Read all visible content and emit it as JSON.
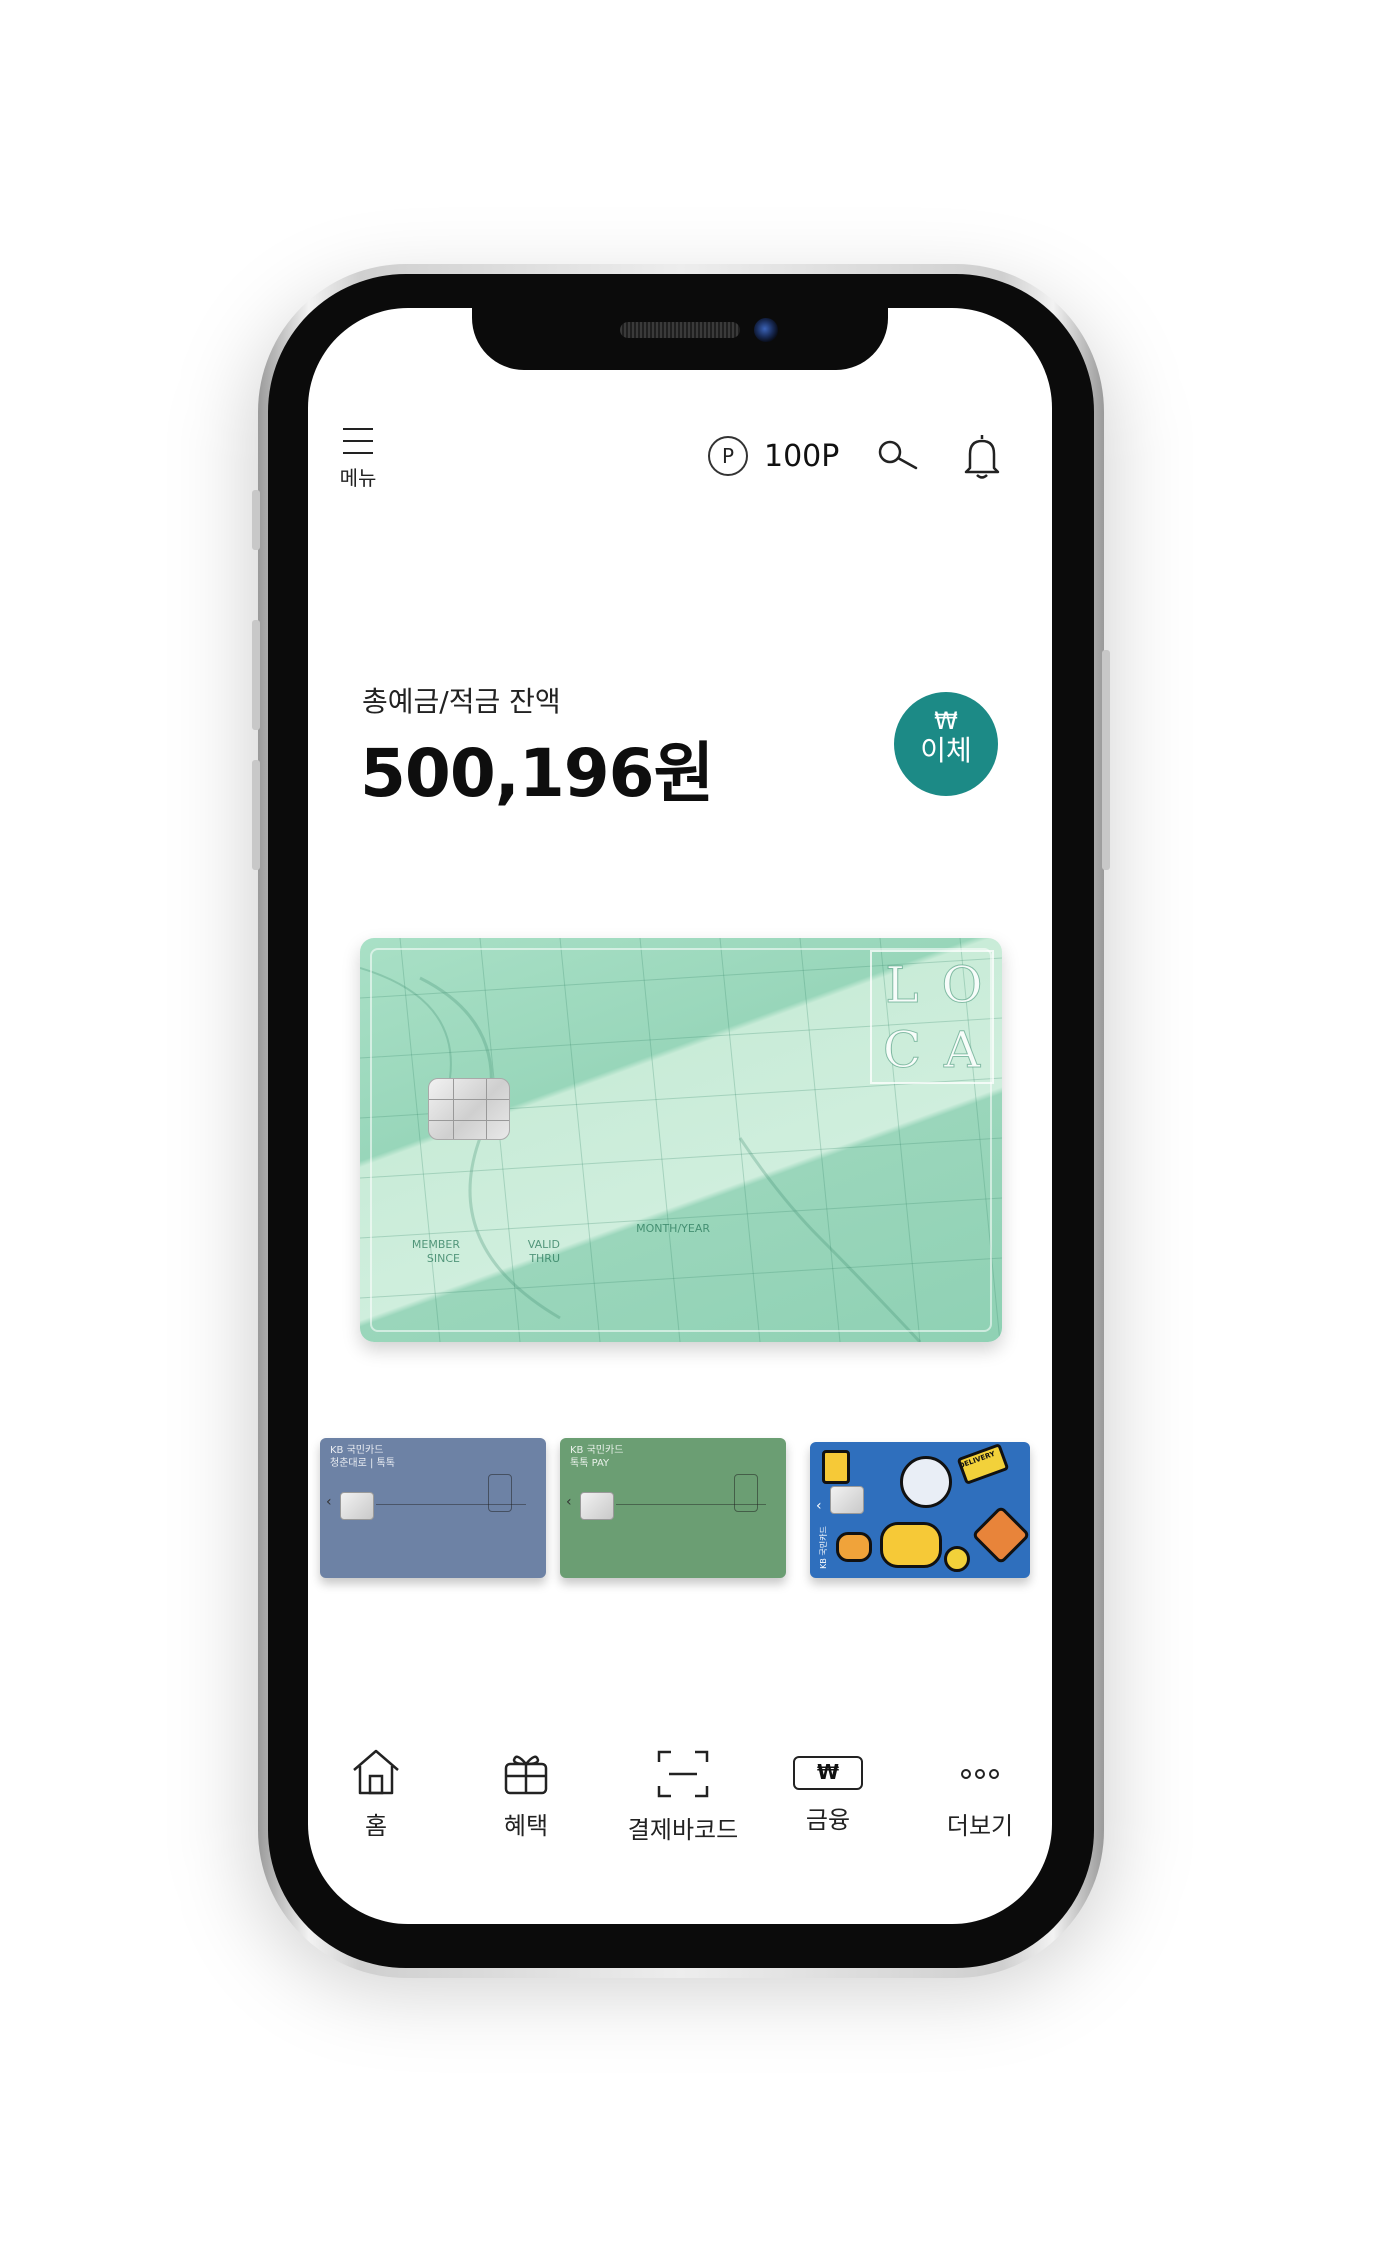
{
  "header": {
    "menu_label": "메뉴",
    "points_icon_letter": "P",
    "points_value": "100P",
    "icons": [
      "menu-icon",
      "points-icon",
      "search-icon",
      "bell-icon"
    ]
  },
  "balance": {
    "label": "총예금/적금 잔액",
    "amount": "500,196원"
  },
  "transfer_button": {
    "symbol": "₩",
    "label": "이체",
    "color": "#1c8a86"
  },
  "main_card": {
    "logo_letters": [
      "L",
      "O",
      "C",
      "A"
    ],
    "member_since": "MEMBER\nSINCE",
    "valid_thru": "VALID\nTHRU",
    "month_year": "MONTH/YEAR",
    "color": "#a9e0c6"
  },
  "mini_cards": [
    {
      "brand": "KB 국민카드",
      "subtitle": "청춘대로 | 톡톡",
      "color": "#6d82a5"
    },
    {
      "brand": "KB 국민카드",
      "subtitle": "톡톡 PAY",
      "color": "#6b9e73"
    },
    {
      "brand": "KB 국민카드",
      "subtitle": "DELIVERY",
      "color": "#2f6fbd"
    }
  ],
  "bottom_nav": [
    {
      "label": "홈",
      "icon": "home-icon"
    },
    {
      "label": "혜택",
      "icon": "gift-icon"
    },
    {
      "label": "결제바코드",
      "icon": "barcode-icon"
    },
    {
      "label": "금융",
      "icon": "won-icon",
      "icon_text": "₩"
    },
    {
      "label": "더보기",
      "icon": "more-icon"
    }
  ]
}
